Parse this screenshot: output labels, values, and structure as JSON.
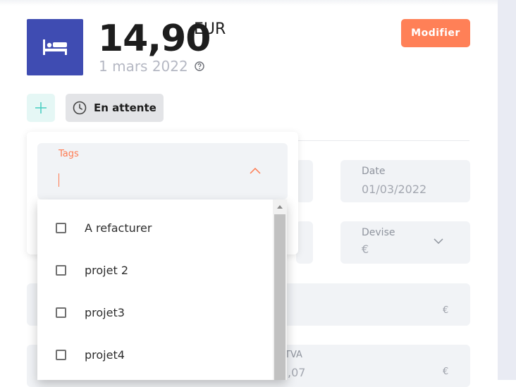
{
  "expense": {
    "amount": "14,90",
    "currency": "EUR",
    "date": "1 mars 2022",
    "category_icon": "bed-icon"
  },
  "actions": {
    "modify_label": "Modifier",
    "status_label": "En attente"
  },
  "form": {
    "date_label": "Date",
    "date_value": "01/03/2022",
    "devise_label": "Devise",
    "devise_value": "€",
    "euro_symbol": "€",
    "tva_label_partial": "TVA",
    "tva_value_partial": ",07"
  },
  "tags": {
    "label": "Tags",
    "options": [
      {
        "label": "A refacturer",
        "checked": false
      },
      {
        "label": "projet 2",
        "checked": false
      },
      {
        "label": "projet3",
        "checked": false
      },
      {
        "label": "projet4",
        "checked": false
      }
    ]
  },
  "colors": {
    "accent": "#ff8057",
    "category_tile": "#3f4cb2",
    "add_button_bg": "#e5f7f5",
    "add_icon": "#4ccfc3"
  }
}
